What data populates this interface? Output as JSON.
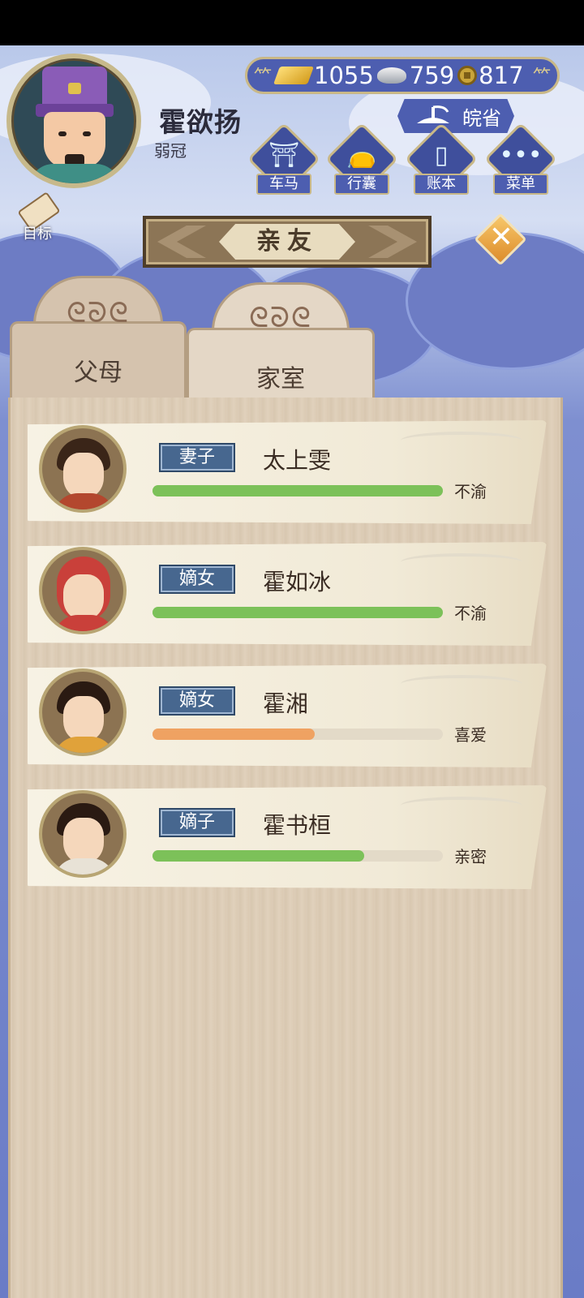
{
  "player": {
    "name": "霍欲扬",
    "title": "弱冠"
  },
  "resources": {
    "gold": "1055",
    "silver": "759",
    "coins": "817"
  },
  "region": {
    "label": "皖省",
    "icon": "scale-icon"
  },
  "menu": [
    {
      "label": "车马",
      "icon": "carriage-icon"
    },
    {
      "label": "行囊",
      "icon": "bag-icon"
    },
    {
      "label": "账本",
      "icon": "ledger-icon"
    },
    {
      "label": "菜单",
      "icon": "more-icon"
    }
  ],
  "goal": {
    "label": "目标"
  },
  "banner": {
    "title": "亲友"
  },
  "tabs": [
    {
      "label": "父母"
    },
    {
      "label": "家室"
    }
  ],
  "members": [
    {
      "role": "妻子",
      "name": "太上雯",
      "mood": "不渝",
      "bar": 1.0,
      "bar_color": "#7cc159",
      "hair": "#3a2518",
      "robe": "#b3472e"
    },
    {
      "role": "嫡女",
      "name": "霍如冰",
      "mood": "不渝",
      "bar": 1.0,
      "bar_color": "#7cc159",
      "hair": "#c9403a",
      "robe": "#c9403a"
    },
    {
      "role": "嫡女",
      "name": "霍湘",
      "mood": "喜爱",
      "bar": 0.56,
      "bar_color": "#efa262",
      "hair": "#2a1a12",
      "robe": "#e0a23a"
    },
    {
      "role": "嫡子",
      "name": "霍书桓",
      "mood": "亲密",
      "bar": 0.73,
      "bar_color": "#7cc159",
      "hair": "#2a1a12",
      "robe": "#e8e2d6"
    }
  ],
  "colors": {
    "accent_blue": "#4d5eb0",
    "gold_border": "#c9b887",
    "role_tag": "#47678f"
  }
}
